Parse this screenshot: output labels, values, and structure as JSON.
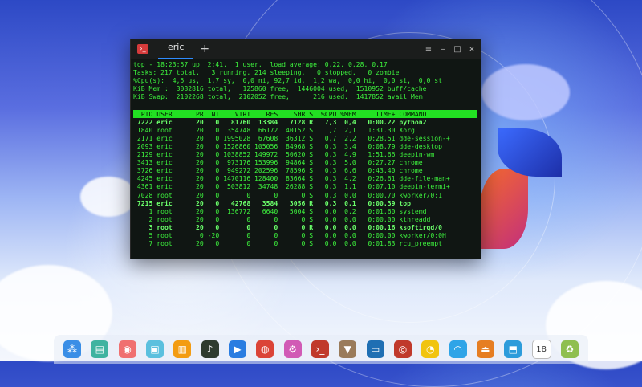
{
  "terminal": {
    "tab_label": "eric",
    "tab_add": "+",
    "controls": {
      "menu": "≡",
      "minimize": "–",
      "maximize": "□",
      "close": "×"
    },
    "summary": [
      "top - 18:23:57 up  2:41,  1 user,  load average: 0,22, 0,28, 0,17",
      "Tasks: 217 total,   3 running, 214 sleeping,   0 stopped,   0 zombie",
      "%Cpu(s):  4,5 us,  1,7 sy,  0,0 ni, 92,7 id,  1,2 wa,  0,0 hi,  0,0 si,  0,0 st",
      "KiB Mem :  3082816 total,   125860 free,  1446004 used,  1510952 buff/cache",
      "KiB Swap:  2102268 total,  2102052 free,      216 used.  1417852 avail Mem"
    ],
    "header": "  PID USER      PR  NI    VIRT    RES    SHR S  %CPU %MEM     TIME+ COMMAND",
    "processes": [
      {
        "text": " 7222 eric      20   0   81760  13384   7128 R   7,3  0,4   0:00.22 python2",
        "bold": true
      },
      {
        "text": " 1840 root      20   0  354748  66172  40152 S   1,7  2,1   1:31.30 Xorg",
        "bold": false
      },
      {
        "text": " 2171 eric      20   0 1995028  67608  36312 S   0,7  2,2   0:28.51 dde-session-+",
        "bold": false
      },
      {
        "text": " 2093 eric      20   0 1526860 105056  84968 S   0,3  3,4   0:08.79 dde-desktop",
        "bold": false
      },
      {
        "text": " 2129 eric      20   0 1038852 149972  50620 S   0,3  4,9   1:51.66 deepin-wm",
        "bold": false
      },
      {
        "text": " 3413 eric      20   0  973176 153996  94864 S   0,3  5,0   0:27.27 chrome",
        "bold": false
      },
      {
        "text": " 3726 eric      20   0  949272 202596  78596 S   0,3  6,6   0:43.40 chrome",
        "bold": false
      },
      {
        "text": " 4245 eric      20   0 1470116 128400  83664 S   0,3  4,2   0:26.61 dde-file-man+",
        "bold": false
      },
      {
        "text": " 4361 eric      20   0  503812  34748  26288 S   0,3  1,1   0:07.10 deepin-termi+",
        "bold": false
      },
      {
        "text": " 7028 root      20   0       0      0      0 S   0,3  0,0   0:00.70 kworker/0:1",
        "bold": false
      },
      {
        "text": " 7215 eric      20   0   42768   3584   3056 R   0,3  0,1   0:00.39 top",
        "bold": true
      },
      {
        "text": "    1 root      20   0  136772   6640   5004 S   0,0  0,2   0:01.60 systemd",
        "bold": false
      },
      {
        "text": "    2 root      20   0       0      0      0 S   0,0  0,0   0:00.00 kthreadd",
        "bold": false
      },
      {
        "text": "    3 root      20   0       0      0      0 R   0,0  0,0   0:00.16 ksoftirqd/0",
        "bold": true
      },
      {
        "text": "    5 root       0 -20       0      0      0 S   0,0  0,0   0:00.00 kworker/0:0H",
        "bold": false
      },
      {
        "text": "    7 root      20   0       0      0      0 S   0,0  0,0   0:01.83 rcu_preempt",
        "bold": false
      }
    ]
  },
  "dock": [
    {
      "name": "launcher-icon",
      "glyph": "⁂",
      "color": "#3a8ee6"
    },
    {
      "name": "file-manager-icon",
      "glyph": "▤",
      "color": "#3fb3a0"
    },
    {
      "name": "screen-recorder-icon",
      "glyph": "◉",
      "color": "#f07070"
    },
    {
      "name": "folder-icon",
      "glyph": "▣",
      "color": "#5bc0de"
    },
    {
      "name": "archive-manager-icon",
      "glyph": "▥",
      "color": "#f39c12"
    },
    {
      "name": "music-player-icon",
      "glyph": "♪",
      "color": "#2e3b2e"
    },
    {
      "name": "movie-player-icon",
      "glyph": "▶",
      "color": "#2a7de1"
    },
    {
      "name": "chrome-icon",
      "glyph": "◍",
      "color": "#db4437"
    },
    {
      "name": "settings-icon",
      "glyph": "⚙",
      "color": "#d15ab5"
    },
    {
      "name": "terminal-icon",
      "glyph": "›_",
      "color": "#c0392b"
    },
    {
      "name": "installer-icon",
      "glyph": "▼",
      "color": "#9a7b5a"
    },
    {
      "name": "remote-desktop-icon",
      "glyph": "▭",
      "color": "#1f6fb3"
    },
    {
      "name": "screenshot-icon",
      "glyph": "◎",
      "color": "#c0392b"
    },
    {
      "name": "clock-icon",
      "glyph": "◔",
      "color": "#f1c40f"
    },
    {
      "name": "wifi-icon",
      "glyph": "◠",
      "color": "#2fa4e7"
    },
    {
      "name": "eject-icon",
      "glyph": "⏏",
      "color": "#e67e22"
    },
    {
      "name": "app-store-icon",
      "glyph": "⬒",
      "color": "#2d9cdb"
    },
    {
      "name": "calendar-icon",
      "glyph": "18",
      "color": "#ffffff"
    },
    {
      "name": "trash-icon",
      "glyph": "♻",
      "color": "#8fbf4f"
    }
  ]
}
